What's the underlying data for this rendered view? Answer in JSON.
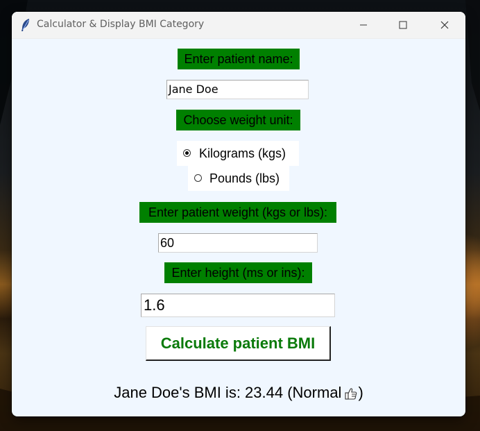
{
  "window": {
    "title": "Calculator & Display BMI Category"
  },
  "form": {
    "name_label": "Enter patient name:",
    "name_value": "Jane Doe",
    "unit_label": "Choose weight unit:",
    "unit_options": [
      {
        "label": "Kilograms (kgs)",
        "selected": true
      },
      {
        "label": "Pounds (lbs)",
        "selected": false
      }
    ],
    "weight_label": "Enter patient weight (kgs or lbs):",
    "weight_value": "60",
    "height_label": "Enter height (ms or ins):",
    "height_value": "1.6",
    "calculate_label": "Calculate patient BMI"
  },
  "result": {
    "prefix": "Jane Doe's BMI is: 23.44 (Normal",
    "suffix": ")",
    "icon": "thumbs-up-icon"
  },
  "colors": {
    "label_background": "#008000",
    "button_text": "#0a7a0a",
    "window_background": "#f0f7ff"
  }
}
